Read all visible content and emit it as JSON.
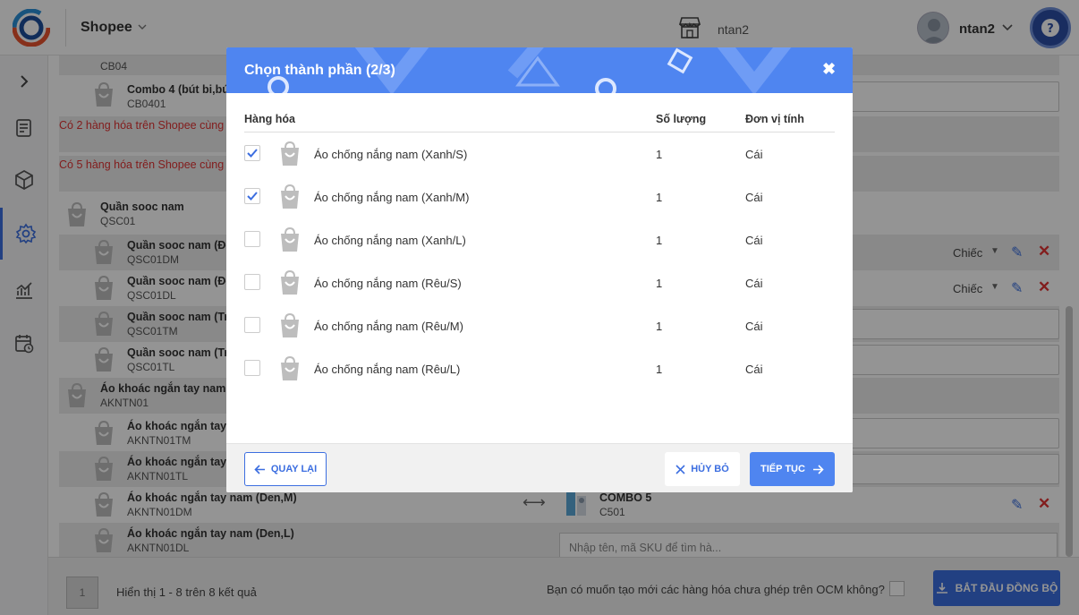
{
  "header": {
    "shop_name": "Shopee",
    "store_user": "ntan2",
    "user_name": "ntan2"
  },
  "background": {
    "rows": [
      {
        "title": "",
        "sku": "CB04"
      },
      {
        "title": "Combo 4 (bút bi,bú",
        "sku": "CB0401"
      },
      {
        "title": "Quần sooc nam",
        "sku": "QSC01"
      },
      {
        "title": "Quần sooc nam (Đe",
        "sku": "QSC01DM"
      },
      {
        "title": "Quần sooc nam (Đe",
        "sku": "QSC01DL"
      },
      {
        "title": "Quần sooc nam (Tr",
        "sku": "QSC01TM"
      },
      {
        "title": "Quần sooc nam (Tr",
        "sku": "QSC01TL"
      },
      {
        "title": "Áo khoác ngắn tay nam",
        "sku": "AKNTN01"
      },
      {
        "title": "Áo khoác ngắn tay",
        "sku": "AKNTN01TM"
      },
      {
        "title": "Áo khoác ngắn tay",
        "sku": "AKNTN01TL"
      },
      {
        "title": "Áo khoác ngắn tay nam (Den,M)",
        "sku": "AKNTN01DM"
      },
      {
        "title": "Áo khoác ngắn tay nam (Den,L)",
        "sku": "AKNTN01DL"
      }
    ],
    "warning_1": "Có 2 hàng hóa trên Shopee cùng",
    "warning_2": "Có 5 hàng hóa trên Shopee cùng",
    "unit_1": "Chiếc",
    "unit_2": "Chiếc",
    "combo_title": "COMBO 5",
    "combo_sku": "C501",
    "search_placeholder": "Nhập tên, mã SKU để tìm hà..."
  },
  "footer": {
    "page": "1",
    "page_info": "Hiển thị 1 - 8 trên 8 kết quả",
    "create_question": "Bạn có muốn tạo mới các hàng hóa chưa ghép trên OCM không?",
    "sync_label": "BẮT ĐẦU ĐỒNG BỘ"
  },
  "modal": {
    "title": "Chọn thành phần (2/3)",
    "columns": {
      "item": "Hàng hóa",
      "qty": "Số lượng",
      "unit": "Đơn vị tính"
    },
    "items": [
      {
        "name": "Áo chống nắng nam (Xanh/S)",
        "qty": "1",
        "unit": "Cái",
        "checked": true
      },
      {
        "name": "Áo chống nắng nam (Xanh/M)",
        "qty": "1",
        "unit": "Cái",
        "checked": true
      },
      {
        "name": "Áo chống nắng nam (Xanh/L)",
        "qty": "1",
        "unit": "Cái",
        "checked": false
      },
      {
        "name": "Áo chống nắng nam (Rêu/S)",
        "qty": "1",
        "unit": "Cái",
        "checked": false
      },
      {
        "name": "Áo chống nắng nam (Rêu/M)",
        "qty": "1",
        "unit": "Cái",
        "checked": false
      },
      {
        "name": "Áo chống nắng nam (Rêu/L)",
        "qty": "1",
        "unit": "Cái",
        "checked": false
      }
    ],
    "back_label": "QUAY LẠI",
    "cancel_label": "HỦY BỎ",
    "next_label": "TIẾP TỤC"
  },
  "colors": {
    "accent": "#3c6ee0",
    "modal_header": "#4f85f0",
    "danger": "#e13232"
  }
}
